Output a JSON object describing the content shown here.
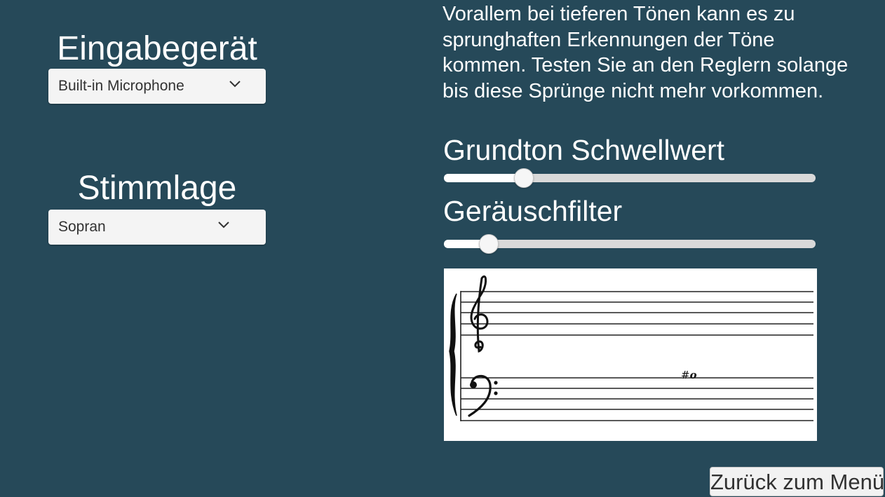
{
  "input_device": {
    "heading": "Eingabegerät",
    "selected": "Built-in Microphone",
    "icon": "chevron-down-icon"
  },
  "voice_range": {
    "heading": "Stimmlage",
    "selected": "Sopran",
    "icon": "chevron-down-icon"
  },
  "info_text": "Vorallem bei tieferen Tönen kann es zu sprunghaften Erkennungen der Töne kommen. Testen Sie an den Reglern solange bis diese Sprünge nicht mehr vorkommen.",
  "sliders": [
    {
      "label": "Grundton Schwellwert",
      "value_fraction": 0.215
    },
    {
      "label": "Geräuschfilter",
      "value_fraction": 0.12
    }
  ],
  "staff": {
    "note_accidental": "#",
    "note_glyph": "o"
  },
  "back_button": {
    "label": "Zurück zum Menü"
  },
  "colors": {
    "background": "#264959",
    "panel": "#f4f4f4",
    "text_dark": "#323232"
  }
}
